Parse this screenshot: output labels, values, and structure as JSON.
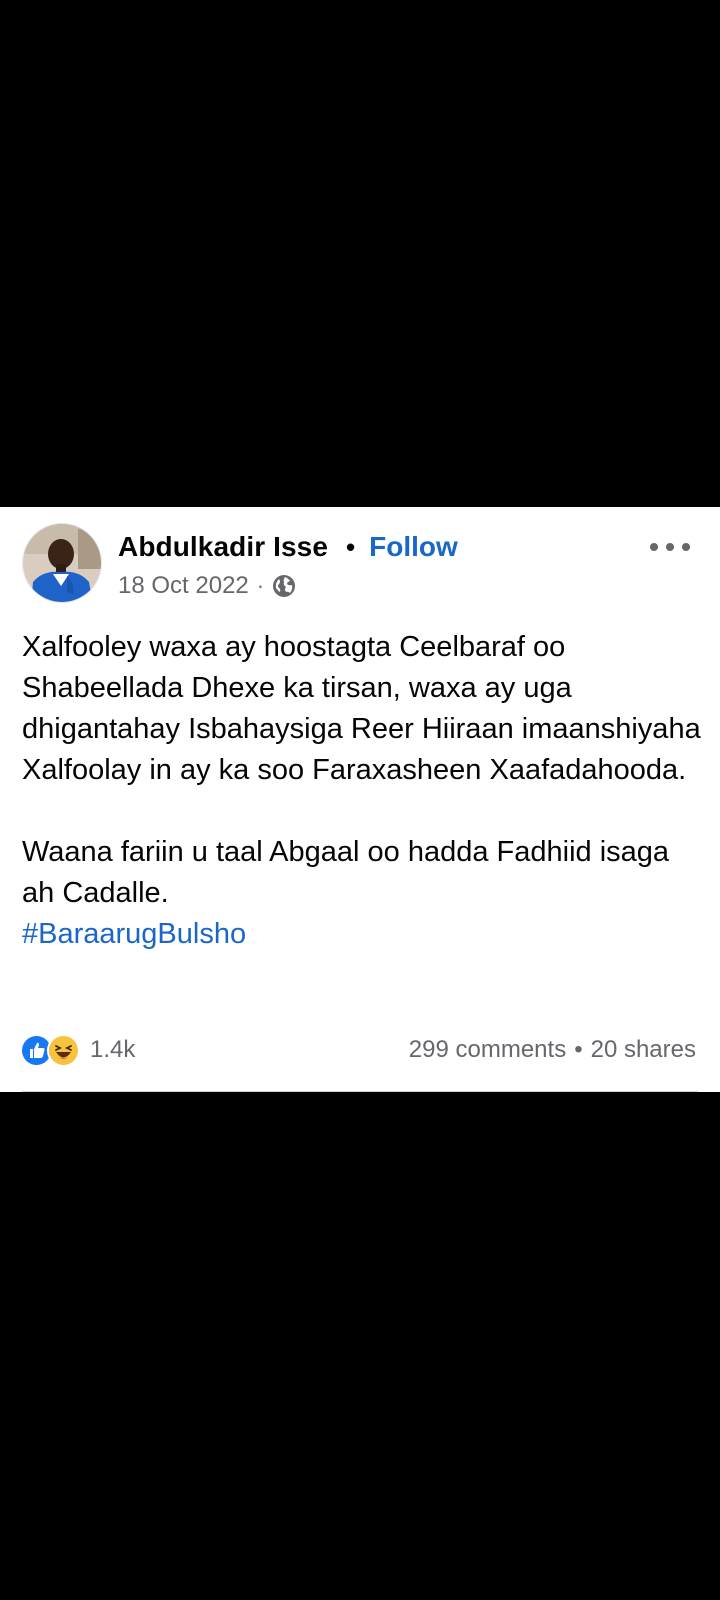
{
  "post": {
    "author": "Abdulkadir Isse",
    "separator": "•",
    "follow_label": "Follow",
    "date": "18 Oct 2022",
    "meta_separator": "·",
    "privacy_icon": "globe-icon",
    "more_icon": "more-horizontal-icon",
    "paragraphs": [
      "Xalfooley waxa ay hoostagta Ceelbaraf oo Shabeellada Dhexe ka tirsan, waxa ay uga dhigantahay Isbahaysiga Reer Hiiraan imaanshiyaha Xalfoolay in ay ka soo Faraxasheen Xaafadahooda.",
      "Waana fariin u taal Abgaal oo hadda Fadhiid isaga ah Cadalle."
    ],
    "hashtag": "#BaraarugBulsho",
    "reactions": {
      "icons": [
        "like-reaction-icon",
        "haha-reaction-icon"
      ],
      "count": "1.4k"
    },
    "comments": "299 comments",
    "stats_separator": "•",
    "shares": "20 shares"
  },
  "colors": {
    "background": "#000000",
    "card": "#ffffff",
    "link": "#1b66c9",
    "secondary_text": "#65676b",
    "like_blue": "#1877f2",
    "haha_yellow": "#f7c33c"
  }
}
